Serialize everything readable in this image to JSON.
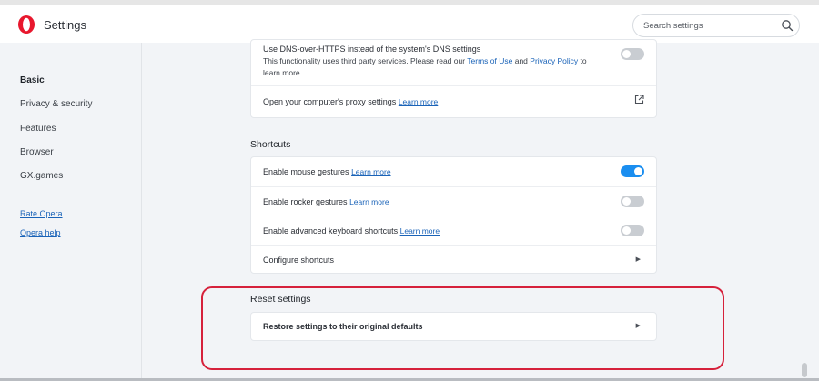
{
  "header": {
    "title": "Settings",
    "search_placeholder": "Search settings"
  },
  "sidebar": {
    "items": [
      {
        "label": "Basic",
        "active": true
      },
      {
        "label": "Privacy & security"
      },
      {
        "label": "Features"
      },
      {
        "label": "Browser"
      },
      {
        "label": "GX.games"
      }
    ],
    "links": [
      "Rate Opera",
      "Opera help"
    ]
  },
  "dns": {
    "title": "Use DNS-over-HTTPS instead of the system's DNS settings",
    "desc_1": "This functionality uses third party services. Please read our",
    "terms_link": "Terms of Use",
    "and": "and",
    "privacy_link": "Privacy Policy",
    "to": "to",
    "desc_2": "learn more.",
    "enabled": false
  },
  "proxy": {
    "label": "Open your computer's proxy settings",
    "link": "Learn more"
  },
  "shortcuts": {
    "title": "Shortcuts",
    "rows": [
      {
        "label": "Enable mouse gestures",
        "link": "Learn more",
        "enabled": true
      },
      {
        "label": "Enable rocker gestures",
        "link": "Learn more",
        "enabled": false
      },
      {
        "label": "Enable advanced keyboard shortcuts",
        "link": "Learn more",
        "enabled": false
      }
    ],
    "configure_label": "Configure shortcuts"
  },
  "reset": {
    "title": "Reset settings",
    "restore_label": "Restore settings to their original defaults"
  },
  "colors": {
    "accent": "#1a8ef0",
    "highlight": "#d6213b",
    "brand": "#e8172d"
  }
}
